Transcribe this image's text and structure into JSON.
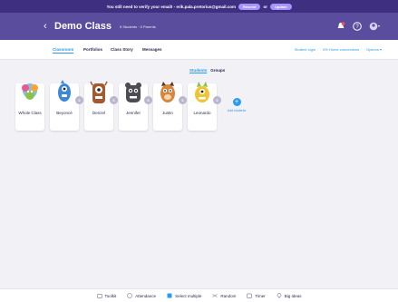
{
  "banner": {
    "message": "You still need to verify your email! - erik.pala.pretorius@gmail.com",
    "resend_label": "Resend",
    "or_text": "or",
    "update_label": "Update"
  },
  "header": {
    "back_glyph": "‹",
    "class_name": "Demo Class",
    "class_meta": "5 Students · 0 Parents"
  },
  "tabs": [
    {
      "label": "Classroom",
      "active": true
    },
    {
      "label": "Portfolios",
      "active": false
    },
    {
      "label": "Class Story",
      "active": false
    },
    {
      "label": "Messages",
      "active": false
    }
  ],
  "right_links": {
    "student_login": "Student login",
    "home_connections": "0% Home connections",
    "options": "Options ▾"
  },
  "segment": {
    "students": "Students",
    "groups": "Groups"
  },
  "students": [
    {
      "name": "Whole Class",
      "points": "",
      "color": "#f5a53a"
    },
    {
      "name": "Beyoncé",
      "points": "0",
      "color": "#3d88d6"
    },
    {
      "name": "Denzel",
      "points": "0",
      "color": "#a35a2f"
    },
    {
      "name": "Jennifer",
      "points": "0",
      "color": "#4c4c54"
    },
    {
      "name": "Justin",
      "points": "0",
      "color": "#d9853a"
    },
    {
      "name": "Leonardo",
      "points": "0",
      "color": "#f0c533"
    }
  ],
  "add_students_label": "Add students",
  "toolbar": {
    "toolkit": "Toolkit",
    "attendance": "Attendance",
    "select_multiple": "Select multiple",
    "random": "Random",
    "timer": "Timer",
    "big_ideas": "Big Ideas"
  },
  "colors": {
    "accent": "#2b9bf0",
    "header": "#5b4d9e",
    "banner": "#3f2f80"
  }
}
